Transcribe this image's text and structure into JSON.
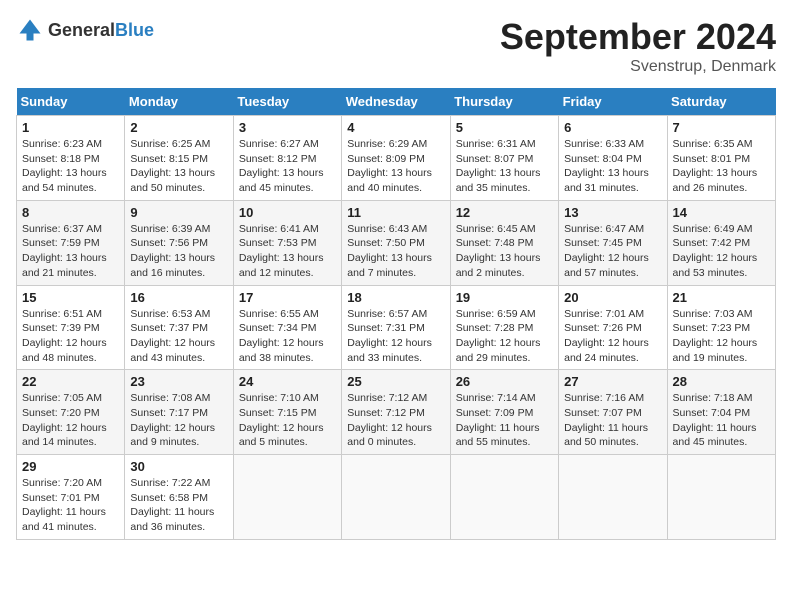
{
  "header": {
    "logo_general": "General",
    "logo_blue": "Blue",
    "month_title": "September 2024",
    "location": "Svenstrup, Denmark"
  },
  "days_of_week": [
    "Sunday",
    "Monday",
    "Tuesday",
    "Wednesday",
    "Thursday",
    "Friday",
    "Saturday"
  ],
  "weeks": [
    [
      {
        "day": "1",
        "info": "Sunrise: 6:23 AM\nSunset: 8:18 PM\nDaylight: 13 hours\nand 54 minutes."
      },
      {
        "day": "2",
        "info": "Sunrise: 6:25 AM\nSunset: 8:15 PM\nDaylight: 13 hours\nand 50 minutes."
      },
      {
        "day": "3",
        "info": "Sunrise: 6:27 AM\nSunset: 8:12 PM\nDaylight: 13 hours\nand 45 minutes."
      },
      {
        "day": "4",
        "info": "Sunrise: 6:29 AM\nSunset: 8:09 PM\nDaylight: 13 hours\nand 40 minutes."
      },
      {
        "day": "5",
        "info": "Sunrise: 6:31 AM\nSunset: 8:07 PM\nDaylight: 13 hours\nand 35 minutes."
      },
      {
        "day": "6",
        "info": "Sunrise: 6:33 AM\nSunset: 8:04 PM\nDaylight: 13 hours\nand 31 minutes."
      },
      {
        "day": "7",
        "info": "Sunrise: 6:35 AM\nSunset: 8:01 PM\nDaylight: 13 hours\nand 26 minutes."
      }
    ],
    [
      {
        "day": "8",
        "info": "Sunrise: 6:37 AM\nSunset: 7:59 PM\nDaylight: 13 hours\nand 21 minutes."
      },
      {
        "day": "9",
        "info": "Sunrise: 6:39 AM\nSunset: 7:56 PM\nDaylight: 13 hours\nand 16 minutes."
      },
      {
        "day": "10",
        "info": "Sunrise: 6:41 AM\nSunset: 7:53 PM\nDaylight: 13 hours\nand 12 minutes."
      },
      {
        "day": "11",
        "info": "Sunrise: 6:43 AM\nSunset: 7:50 PM\nDaylight: 13 hours\nand 7 minutes."
      },
      {
        "day": "12",
        "info": "Sunrise: 6:45 AM\nSunset: 7:48 PM\nDaylight: 13 hours\nand 2 minutes."
      },
      {
        "day": "13",
        "info": "Sunrise: 6:47 AM\nSunset: 7:45 PM\nDaylight: 12 hours\nand 57 minutes."
      },
      {
        "day": "14",
        "info": "Sunrise: 6:49 AM\nSunset: 7:42 PM\nDaylight: 12 hours\nand 53 minutes."
      }
    ],
    [
      {
        "day": "15",
        "info": "Sunrise: 6:51 AM\nSunset: 7:39 PM\nDaylight: 12 hours\nand 48 minutes."
      },
      {
        "day": "16",
        "info": "Sunrise: 6:53 AM\nSunset: 7:37 PM\nDaylight: 12 hours\nand 43 minutes."
      },
      {
        "day": "17",
        "info": "Sunrise: 6:55 AM\nSunset: 7:34 PM\nDaylight: 12 hours\nand 38 minutes."
      },
      {
        "day": "18",
        "info": "Sunrise: 6:57 AM\nSunset: 7:31 PM\nDaylight: 12 hours\nand 33 minutes."
      },
      {
        "day": "19",
        "info": "Sunrise: 6:59 AM\nSunset: 7:28 PM\nDaylight: 12 hours\nand 29 minutes."
      },
      {
        "day": "20",
        "info": "Sunrise: 7:01 AM\nSunset: 7:26 PM\nDaylight: 12 hours\nand 24 minutes."
      },
      {
        "day": "21",
        "info": "Sunrise: 7:03 AM\nSunset: 7:23 PM\nDaylight: 12 hours\nand 19 minutes."
      }
    ],
    [
      {
        "day": "22",
        "info": "Sunrise: 7:05 AM\nSunset: 7:20 PM\nDaylight: 12 hours\nand 14 minutes."
      },
      {
        "day": "23",
        "info": "Sunrise: 7:08 AM\nSunset: 7:17 PM\nDaylight: 12 hours\nand 9 minutes."
      },
      {
        "day": "24",
        "info": "Sunrise: 7:10 AM\nSunset: 7:15 PM\nDaylight: 12 hours\nand 5 minutes."
      },
      {
        "day": "25",
        "info": "Sunrise: 7:12 AM\nSunset: 7:12 PM\nDaylight: 12 hours\nand 0 minutes."
      },
      {
        "day": "26",
        "info": "Sunrise: 7:14 AM\nSunset: 7:09 PM\nDaylight: 11 hours\nand 55 minutes."
      },
      {
        "day": "27",
        "info": "Sunrise: 7:16 AM\nSunset: 7:07 PM\nDaylight: 11 hours\nand 50 minutes."
      },
      {
        "day": "28",
        "info": "Sunrise: 7:18 AM\nSunset: 7:04 PM\nDaylight: 11 hours\nand 45 minutes."
      }
    ],
    [
      {
        "day": "29",
        "info": "Sunrise: 7:20 AM\nSunset: 7:01 PM\nDaylight: 11 hours\nand 41 minutes."
      },
      {
        "day": "30",
        "info": "Sunrise: 7:22 AM\nSunset: 6:58 PM\nDaylight: 11 hours\nand 36 minutes."
      },
      {
        "day": "",
        "info": ""
      },
      {
        "day": "",
        "info": ""
      },
      {
        "day": "",
        "info": ""
      },
      {
        "day": "",
        "info": ""
      },
      {
        "day": "",
        "info": ""
      }
    ]
  ]
}
